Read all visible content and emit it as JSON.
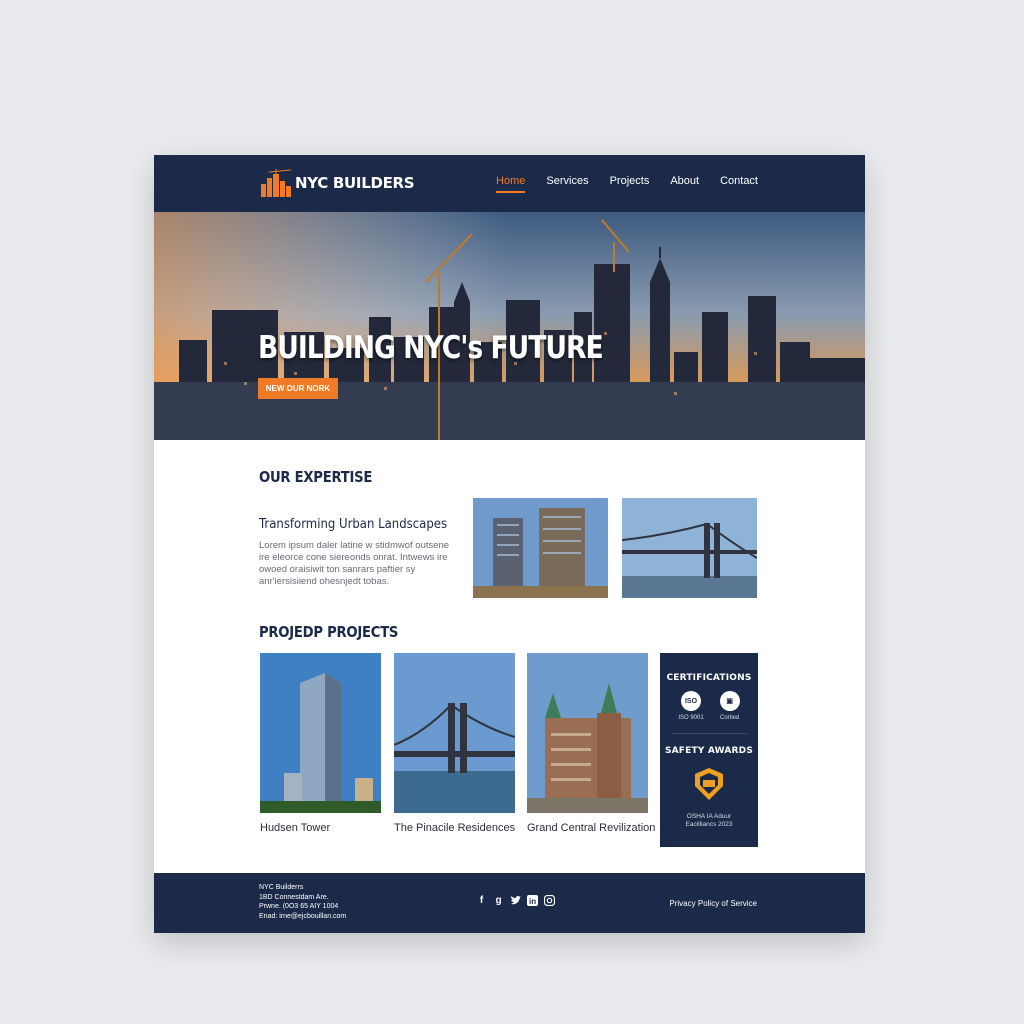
{
  "brand": {
    "name": "NYC BUILDERS"
  },
  "nav": {
    "items": [
      {
        "label": "Home",
        "active": true
      },
      {
        "label": "Services",
        "active": false
      },
      {
        "label": "Projects",
        "active": false
      },
      {
        "label": "About",
        "active": false
      },
      {
        "label": "Contact",
        "active": false
      }
    ]
  },
  "hero": {
    "title": "BUILDING NYC's FUTURE",
    "cta_label": "NEW OUR NORK"
  },
  "expertise": {
    "heading": "OUR EXPERTISE",
    "subheading": "Transforming Urban Landscapes",
    "body": "Lorem ipsum daler latine w stidmwof outsene ire eleorce cone siereonds onrat. Intwews ire owoed oraisiwit ton sanrars paftier sy anr'iersisiiend ohesnjedt tobas."
  },
  "projects": {
    "heading": "PROJEDP PROJECTS",
    "items": [
      {
        "caption": "Hudsen Tower"
      },
      {
        "caption": "The Pinacile Residences"
      },
      {
        "caption": "Grand Central Revilization"
      }
    ]
  },
  "certifications": {
    "heading": "CERTIFICATIONS",
    "badges": [
      {
        "icon_text": "ISO",
        "label": "ISO 9001"
      },
      {
        "icon_text": "▣",
        "label": "Cortied"
      }
    ],
    "awards_heading": "SAFETY AWARDS",
    "awards_text_line1": "OSHA IA Aduur",
    "awards_text_line2": "Eacilliancs 2023"
  },
  "footer": {
    "company": "NYC Builderrs",
    "address": "1BD Connestdam Are.",
    "phone": "Prwne. (0O3 65 AIY 1004",
    "email": "Enad: irne@ejcbouillan.com",
    "policy": "Privacy Policy of Service",
    "social_icons": [
      "facebook-icon",
      "google-plus-icon",
      "twitter-icon",
      "linkedin-icon",
      "instagram-icon"
    ]
  },
  "colors": {
    "navy": "#1c2a4a",
    "accent": "#f07a26"
  }
}
